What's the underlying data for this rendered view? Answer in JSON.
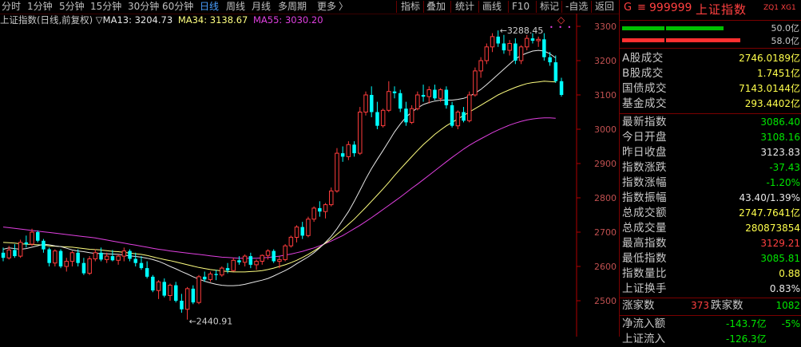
{
  "toolbar": {
    "periods": [
      "分时",
      "1分钟",
      "5分钟",
      "15分钟",
      "30分钟",
      "60分钟",
      "日线",
      "周线",
      "月线",
      "多周期",
      "更多"
    ],
    "active_period": "日线",
    "tools": [
      "指标",
      "叠加",
      "统计",
      "画线",
      "F10",
      "标记",
      "-自选",
      "返回"
    ]
  },
  "chart_header": {
    "title": "上证指数(日线,前复权)",
    "triangle": "▽",
    "ma13_label": "MA13: 3204.73",
    "ma34_label": "MA34: 3138.67",
    "ma55_label": "MA55: 3030.20"
  },
  "colors": {
    "up": "#ff3c3c",
    "down": "#00ffff",
    "ma13": "#e6e6e6",
    "ma34": "#ffff80",
    "ma55": "#e040e0",
    "axis": "#b00000",
    "accent_blue": "#4a9fff",
    "value_yellow": "#ffff4c",
    "value_green": "#00e600",
    "value_red": "#ff4040"
  },
  "chart_data": {
    "type": "candlestick",
    "title": "上证指数(日线,前复权)",
    "yaxis": {
      "min": 2440,
      "max": 3330,
      "ticks": [
        3300,
        3200,
        3100,
        3000,
        2900,
        2800,
        2700,
        2600,
        2500
      ]
    },
    "annotations": {
      "high": "3288.45",
      "low": "2440.91"
    },
    "ohlc": [
      [
        2640,
        2655,
        2615,
        2625
      ],
      [
        2625,
        2660,
        2620,
        2648
      ],
      [
        2648,
        2665,
        2625,
        2630
      ],
      [
        2630,
        2678,
        2625,
        2670
      ],
      [
        2670,
        2690,
        2655,
        2665
      ],
      [
        2665,
        2710,
        2660,
        2700
      ],
      [
        2700,
        2705,
        2670,
        2675
      ],
      [
        2675,
        2680,
        2640,
        2650
      ],
      [
        2650,
        2655,
        2600,
        2610
      ],
      [
        2610,
        2650,
        2600,
        2645
      ],
      [
        2645,
        2650,
        2595,
        2600
      ],
      [
        2600,
        2625,
        2585,
        2615
      ],
      [
        2615,
        2645,
        2600,
        2640
      ],
      [
        2640,
        2650,
        2600,
        2610
      ],
      [
        2610,
        2625,
        2575,
        2580
      ],
      [
        2580,
        2630,
        2575,
        2622
      ],
      [
        2622,
        2650,
        2615,
        2640
      ],
      [
        2640,
        2655,
        2615,
        2620
      ],
      [
        2620,
        2640,
        2610,
        2630
      ],
      [
        2630,
        2648,
        2615,
        2618
      ],
      [
        2618,
        2635,
        2605,
        2630
      ],
      [
        2630,
        2655,
        2615,
        2645
      ],
      [
        2645,
        2650,
        2615,
        2622
      ],
      [
        2622,
        2640,
        2600,
        2610
      ],
      [
        2610,
        2630,
        2590,
        2595
      ],
      [
        2595,
        2615,
        2565,
        2570
      ],
      [
        2570,
        2575,
        2525,
        2530
      ],
      [
        2530,
        2560,
        2505,
        2555
      ],
      [
        2555,
        2565,
        2510,
        2515
      ],
      [
        2515,
        2550,
        2500,
        2545
      ],
      [
        2545,
        2555,
        2495,
        2500
      ],
      [
        2500,
        2520,
        2465,
        2475
      ],
      [
        2475,
        2540,
        2445,
        2535
      ],
      [
        2535,
        2545,
        2490,
        2495
      ],
      [
        2495,
        2575,
        2490,
        2570
      ],
      [
        2570,
        2585,
        2555,
        2562
      ],
      [
        2562,
        2585,
        2555,
        2578
      ],
      [
        2578,
        2590,
        2560,
        2575
      ],
      [
        2575,
        2600,
        2570,
        2595
      ],
      [
        2595,
        2610,
        2580,
        2588
      ],
      [
        2588,
        2625,
        2585,
        2618
      ],
      [
        2618,
        2630,
        2605,
        2612
      ],
      [
        2612,
        2635,
        2600,
        2630
      ],
      [
        2630,
        2640,
        2595,
        2605
      ],
      [
        2605,
        2620,
        2590,
        2615
      ],
      [
        2615,
        2635,
        2605,
        2632
      ],
      [
        2632,
        2650,
        2620,
        2645
      ],
      [
        2645,
        2650,
        2610,
        2615
      ],
      [
        2615,
        2630,
        2595,
        2620
      ],
      [
        2620,
        2665,
        2615,
        2660
      ],
      [
        2660,
        2690,
        2655,
        2685
      ],
      [
        2685,
        2720,
        2670,
        2715
      ],
      [
        2715,
        2730,
        2680,
        2690
      ],
      [
        2690,
        2745,
        2685,
        2738
      ],
      [
        2738,
        2775,
        2730,
        2770
      ],
      [
        2770,
        2790,
        2745,
        2760
      ],
      [
        2760,
        2785,
        2740,
        2780
      ],
      [
        2780,
        2830,
        2775,
        2820
      ],
      [
        2820,
        2945,
        2815,
        2930
      ],
      [
        2930,
        2950,
        2905,
        2920
      ],
      [
        2920,
        2965,
        2910,
        2955
      ],
      [
        2955,
        2965,
        2920,
        2930
      ],
      [
        2930,
        3065,
        2925,
        3050
      ],
      [
        3050,
        3110,
        3040,
        3100
      ],
      [
        3100,
        3125,
        3035,
        3050
      ],
      [
        3050,
        3080,
        3000,
        3010
      ],
      [
        3010,
        3060,
        3005,
        3055
      ],
      [
        3055,
        3140,
        3050,
        3110
      ],
      [
        3110,
        3125,
        3090,
        3105
      ],
      [
        3105,
        3115,
        3050,
        3060
      ],
      [
        3060,
        3080,
        3010,
        3020
      ],
      [
        3020,
        3070,
        3015,
        3060
      ],
      [
        3060,
        3110,
        3055,
        3100
      ],
      [
        3100,
        3130,
        3080,
        3095
      ],
      [
        3095,
        3125,
        3075,
        3115
      ],
      [
        3115,
        3130,
        3085,
        3090
      ],
      [
        3090,
        3120,
        3080,
        3115
      ],
      [
        3115,
        3125,
        3060,
        3070
      ],
      [
        3070,
        3080,
        3005,
        3010
      ],
      [
        3010,
        3055,
        3000,
        3050
      ],
      [
        3050,
        3065,
        3020,
        3025
      ],
      [
        3025,
        3110,
        3020,
        3100
      ],
      [
        3100,
        3180,
        3095,
        3170
      ],
      [
        3170,
        3210,
        3150,
        3200
      ],
      [
        3200,
        3250,
        3190,
        3240
      ],
      [
        3240,
        3280,
        3225,
        3270
      ],
      [
        3270,
        3288,
        3240,
        3250
      ],
      [
        3250,
        3275,
        3220,
        3230
      ],
      [
        3230,
        3260,
        3215,
        3250
      ],
      [
        3250,
        3265,
        3190,
        3200
      ],
      [
        3200,
        3245,
        3190,
        3240
      ],
      [
        3240,
        3275,
        3230,
        3265
      ],
      [
        3265,
        3280,
        3250,
        3258
      ],
      [
        3258,
        3270,
        3240,
        3262
      ],
      [
        3262,
        3280,
        3200,
        3210
      ],
      [
        3210,
        3225,
        3185,
        3195
      ],
      [
        3195,
        3215,
        3135,
        3140
      ],
      [
        3140,
        3150,
        3095,
        3100
      ]
    ],
    "ma13": [
      2650,
      2654,
      2652,
      2650,
      2652,
      2656,
      2660,
      2665,
      2663,
      2660,
      2658,
      2653,
      2648,
      2645,
      2643,
      2640,
      2638,
      2638,
      2637,
      2636,
      2635,
      2633,
      2631,
      2629,
      2627,
      2624,
      2620,
      2615,
      2608,
      2600,
      2593,
      2585,
      2578,
      2570,
      2563,
      2557,
      2552,
      2548,
      2545,
      2544,
      2544,
      2545,
      2548,
      2552,
      2556,
      2560,
      2565,
      2572,
      2580,
      2588,
      2597,
      2608,
      2618,
      2628,
      2640,
      2654,
      2670,
      2688,
      2710,
      2735,
      2760,
      2790,
      2822,
      2855,
      2885,
      2912,
      2938,
      2965,
      2992,
      3015,
      3035,
      3050,
      3062,
      3072,
      3078,
      3082,
      3085,
      3085,
      3085,
      3087,
      3090,
      3096,
      3105,
      3116,
      3130,
      3145,
      3160,
      3175,
      3190,
      3205,
      3215,
      3222,
      3228,
      3230,
      3228,
      3220,
      3208
    ],
    "ma34": [
      2670,
      2669,
      2668,
      2666,
      2665,
      2664,
      2663,
      2662,
      2660,
      2659,
      2658,
      2657,
      2656,
      2654,
      2652,
      2650,
      2649,
      2648,
      2646,
      2644,
      2643,
      2641,
      2639,
      2637,
      2635,
      2632,
      2628,
      2624,
      2620,
      2617,
      2613,
      2609,
      2605,
      2601,
      2597,
      2594,
      2591,
      2589,
      2587,
      2585,
      2584,
      2584,
      2584,
      2585,
      2586,
      2588,
      2591,
      2595,
      2600,
      2605,
      2611,
      2618,
      2626,
      2635,
      2645,
      2656,
      2668,
      2680,
      2694,
      2708,
      2723,
      2738,
      2755,
      2772,
      2790,
      2808,
      2826,
      2845,
      2865,
      2884,
      2902,
      2920,
      2938,
      2955,
      2970,
      2985,
      2998,
      3010,
      3020,
      3030,
      3040,
      3050,
      3060,
      3070,
      3080,
      3090,
      3100,
      3108,
      3115,
      3122,
      3128,
      3133,
      3136,
      3138,
      3140,
      3139,
      3138
    ],
    "ma55": [
      2715,
      2713,
      2711,
      2709,
      2707,
      2705,
      2703,
      2701,
      2699,
      2697,
      2695,
      2693,
      2691,
      2689,
      2687,
      2685,
      2683,
      2680,
      2677,
      2674,
      2671,
      2668,
      2665,
      2662,
      2659,
      2656,
      2653,
      2650,
      2648,
      2645,
      2643,
      2641,
      2639,
      2637,
      2635,
      2633,
      2631,
      2629,
      2627,
      2626,
      2625,
      2624,
      2624,
      2624,
      2624,
      2625,
      2626,
      2628,
      2630,
      2633,
      2636,
      2640,
      2644,
      2649,
      2654,
      2660,
      2667,
      2674,
      2682,
      2690,
      2700,
      2710,
      2720,
      2731,
      2742,
      2754,
      2766,
      2778,
      2790,
      2802,
      2815,
      2828,
      2840,
      2853,
      2866,
      2879,
      2892,
      2905,
      2918,
      2930,
      2942,
      2953,
      2963,
      2972,
      2981,
      2990,
      2998,
      3005,
      3012,
      3018,
      3023,
      3027,
      3030,
      3032,
      3033,
      3033,
      3032
    ]
  },
  "panel": {
    "header": {
      "g": "G",
      "menu": "≡",
      "code": "999999",
      "name": "上证指数",
      "tag": "ZQ1 XG1"
    },
    "ratio_top": "50.0亿",
    "ratio_bottom": "58.0亿",
    "turnover": [
      {
        "label": "A股成交",
        "value": "2746.0189亿",
        "color": "yellow"
      },
      {
        "label": "B股成交",
        "value": "1.7451亿",
        "color": "yellow"
      },
      {
        "label": "国债成交",
        "value": "7143.0144亿",
        "color": "yellow"
      },
      {
        "label": "基金成交",
        "value": "293.4402亿",
        "color": "yellow"
      }
    ],
    "stats": [
      {
        "label": "最新指数",
        "value": "3086.40",
        "color": "green"
      },
      {
        "label": "今日开盘",
        "value": "3108.16",
        "color": "green"
      },
      {
        "label": "昨日收盘",
        "value": "3123.83",
        "color": "white"
      },
      {
        "label": "指数涨跌",
        "value": "-37.43",
        "color": "green"
      },
      {
        "label": "指数涨幅",
        "value": "-1.20%",
        "color": "green"
      },
      {
        "label": "指数振幅",
        "value": "43.40/1.39%",
        "color": "white"
      },
      {
        "label": "总成交额",
        "value": "2747.7641亿",
        "color": "yellow"
      },
      {
        "label": "总成交量",
        "value": "280873854",
        "color": "yellow"
      },
      {
        "label": "最高指数",
        "value": "3129.21",
        "color": "red"
      },
      {
        "label": "最低指数",
        "value": "3085.81",
        "color": "green"
      },
      {
        "label": "指数量比",
        "value": "0.88",
        "color": "yellow"
      },
      {
        "label": "上证换手",
        "value": "0.83%",
        "color": "white"
      }
    ],
    "breadth": {
      "up_label": "涨家数",
      "up_value": "373",
      "down_label": "跌家数",
      "down_value": "1082"
    },
    "netflow": {
      "label": "净流入额",
      "value": "-143.7亿",
      "pct": "-5%"
    },
    "cut_label": "上证流入",
    "cut_value": "-126.3亿"
  }
}
